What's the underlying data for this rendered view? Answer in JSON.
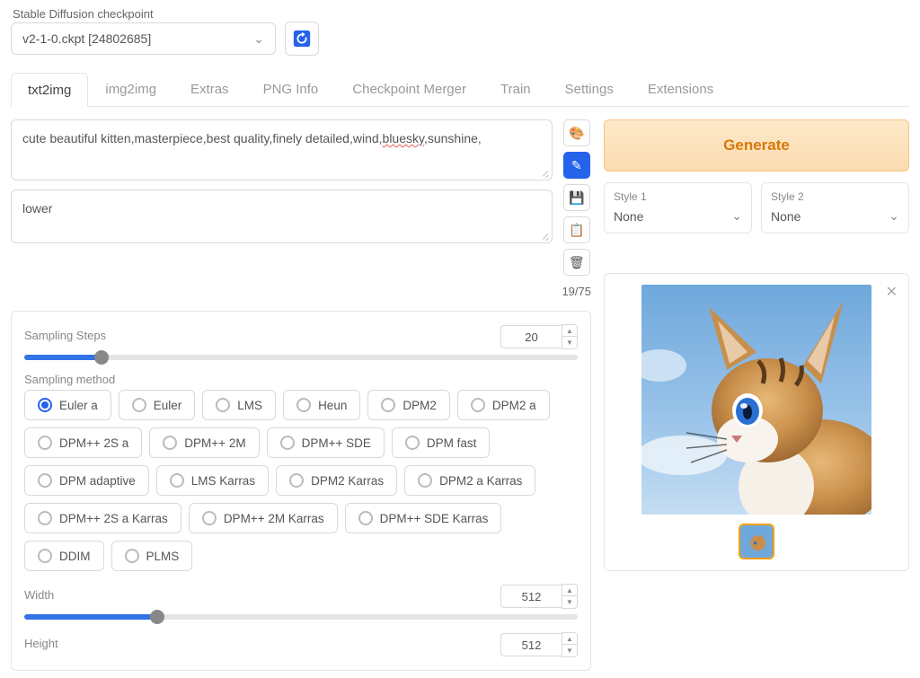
{
  "checkpoint": {
    "label": "Stable Diffusion checkpoint",
    "value": "v2-1-0.ckpt [24802685]"
  },
  "tabs": [
    "txt2img",
    "img2img",
    "Extras",
    "PNG Info",
    "Checkpoint Merger",
    "Train",
    "Settings",
    "Extensions"
  ],
  "active_tab": 0,
  "prompt": {
    "positive_prefix": "cute beautiful kitten,masterpiece,best quality,finely detailed,wind,",
    "positive_mis": "bluesky",
    "positive_suffix": ",sunshine,",
    "negative": "lower"
  },
  "token_count": "19/75",
  "generate_label": "Generate",
  "styles": [
    {
      "label": "Style 1",
      "value": "None"
    },
    {
      "label": "Style 2",
      "value": "None"
    }
  ],
  "sampling_steps": {
    "label": "Sampling Steps",
    "value": 20,
    "fill_pct": 14
  },
  "sampling_method": {
    "label": "Sampling method",
    "selected": "Euler a",
    "options": [
      "Euler a",
      "Euler",
      "LMS",
      "Heun",
      "DPM2",
      "DPM2 a",
      "DPM++ 2S a",
      "DPM++ 2M",
      "DPM++ SDE",
      "DPM fast",
      "DPM adaptive",
      "LMS Karras",
      "DPM2 Karras",
      "DPM2 a Karras",
      "DPM++ 2S a Karras",
      "DPM++ 2M Karras",
      "DPM++ SDE Karras",
      "DDIM",
      "PLMS"
    ]
  },
  "width": {
    "label": "Width",
    "value": 512,
    "fill_pct": 24
  },
  "height": {
    "label": "Height",
    "value": 512
  }
}
